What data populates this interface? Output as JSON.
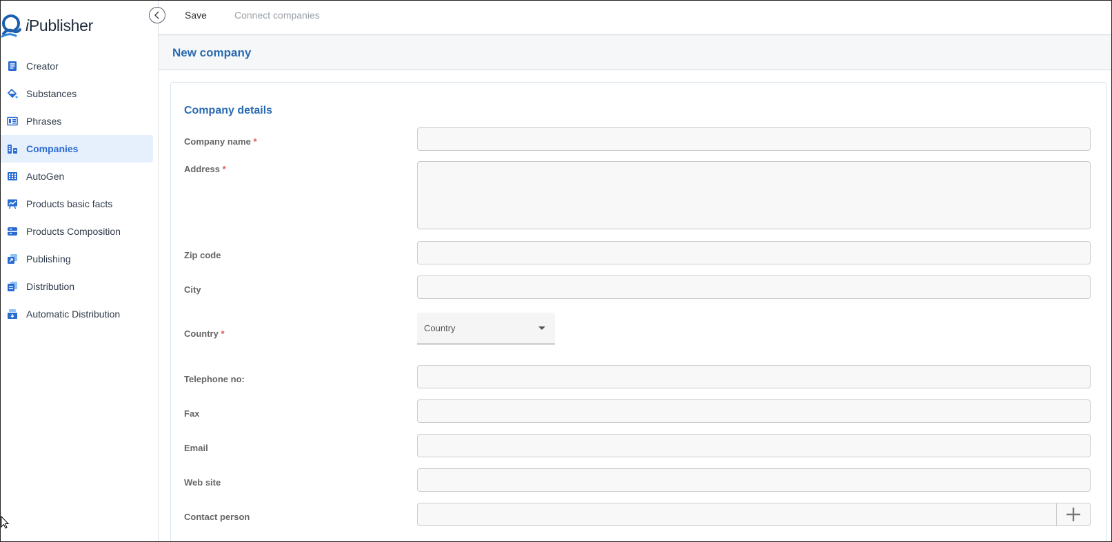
{
  "app": {
    "logo_text_prefix": "i",
    "logo_text_rest": "Publisher",
    "brand_color": "#2a6bd1"
  },
  "toolbar": {
    "save_label": "Save",
    "connect_label": "Connect companies"
  },
  "sidebar": {
    "items": [
      {
        "label": "Creator",
        "icon": "book-icon",
        "active": false
      },
      {
        "label": "Substances",
        "icon": "paint-bucket-icon",
        "active": false
      },
      {
        "label": "Phrases",
        "icon": "phrases-icon",
        "active": false
      },
      {
        "label": "Companies",
        "icon": "buildings-icon",
        "active": true
      },
      {
        "label": "AutoGen",
        "icon": "grid-icon",
        "active": false
      },
      {
        "label": "Products basic facts",
        "icon": "chart-board-icon",
        "active": false
      },
      {
        "label": "Products Composition",
        "icon": "composition-icon",
        "active": false
      },
      {
        "label": "Publishing",
        "icon": "publish-icon",
        "active": false
      },
      {
        "label": "Distribution",
        "icon": "distribution-icon",
        "active": false
      },
      {
        "label": "Automatic Distribution",
        "icon": "auto-distribution-icon",
        "active": false
      }
    ]
  },
  "page": {
    "title": "New company"
  },
  "form": {
    "section_title": "Company details",
    "required_marker": "*",
    "company_name_label": "Company name",
    "address_label": "Address",
    "zip_label": "Zip code",
    "city_label": "City",
    "country_label": "Country",
    "country_placeholder": "Country",
    "telephone_label": "Telephone no:",
    "fax_label": "Fax",
    "email_label": "Email",
    "website_label": "Web site",
    "contact_label": "Contact person"
  }
}
